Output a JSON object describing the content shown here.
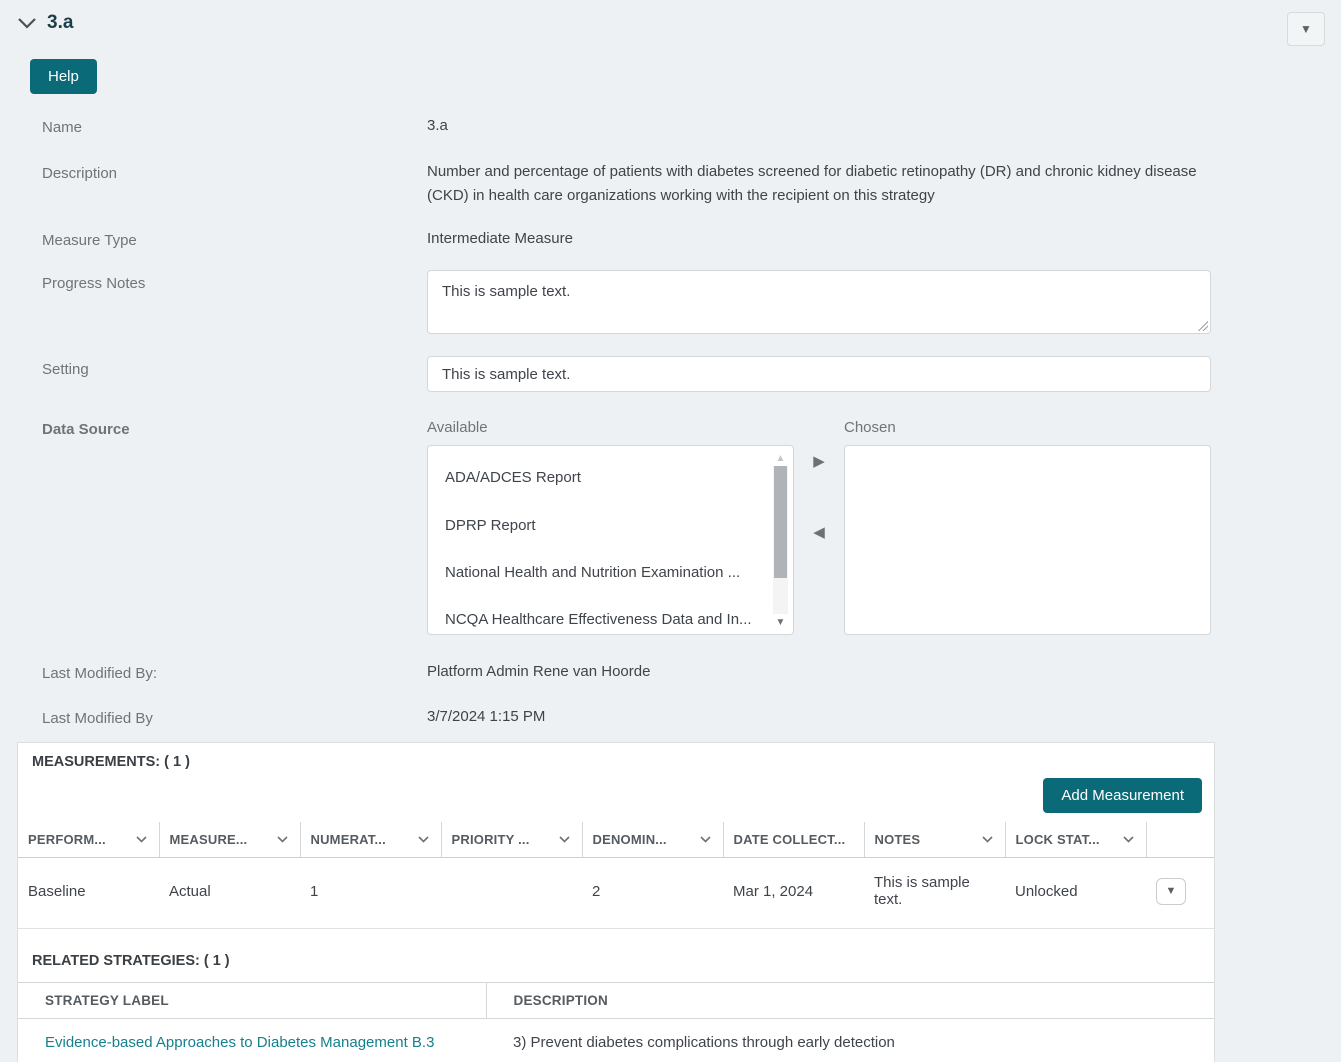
{
  "header": {
    "section_title": "3.a",
    "collapse_icon": "chevron-down",
    "menu_icon": "caret-down",
    "help_button_label": "Help"
  },
  "fields": {
    "name": {
      "label": "Name",
      "value": "3.a"
    },
    "description": {
      "label": "Description",
      "value": "Number and percentage of patients with diabetes screened for diabetic retinopathy (DR) and chronic kidney disease (CKD) in health care organizations working with the recipient on this strategy"
    },
    "measure_type": {
      "label": "Measure Type",
      "value": "Intermediate Measure"
    },
    "progress_notes": {
      "label": "Progress Notes",
      "value": "This is sample text."
    },
    "setting": {
      "label": "Setting",
      "value": "This is sample text."
    },
    "data_source": {
      "label": "Data Source",
      "available_label": "Available",
      "chosen_label": "Chosen",
      "available_options": [
        "ADA/ADCES Report",
        "DPRP Report",
        "National Health and Nutrition Examination ...",
        "NCQA Healthcare Effectiveness Data and In..."
      ],
      "chosen_options": []
    },
    "last_modified_by": {
      "label": "Last Modified By:",
      "value": "Platform Admin Rene van Hoorde"
    },
    "last_modified_date": {
      "label": "Last Modified By",
      "value": "3/7/2024 1:15 PM"
    }
  },
  "measurements": {
    "title": "MEASUREMENTS: ( 1 )",
    "add_button_label": "Add Measurement",
    "columns": [
      {
        "label": "PERFORM..."
      },
      {
        "label": "MEASURE..."
      },
      {
        "label": "NUMERAT..."
      },
      {
        "label": "PRIORITY ..."
      },
      {
        "label": "DENOMIN..."
      },
      {
        "label": "DATE COLLECT..."
      },
      {
        "label": "NOTES"
      },
      {
        "label": "LOCK STAT..."
      },
      {
        "label": ""
      }
    ],
    "rows": [
      {
        "performance": "Baseline",
        "measure": "Actual",
        "numerator": "1",
        "priority": "",
        "denominator": "2",
        "date_collected": "Mar 1, 2024",
        "notes": "This is sample text.",
        "lock_status": "Unlocked"
      }
    ]
  },
  "related_strategies": {
    "title": "RELATED STRATEGIES: ( 1 )",
    "columns": {
      "label": "STRATEGY LABEL",
      "description": "DESCRIPTION"
    },
    "rows": [
      {
        "label": "Evidence-based Approaches to Diabetes Management B.3",
        "description": "3) Prevent diabetes complications through early detection"
      }
    ]
  },
  "colors": {
    "accent_teal": "#0b6a77",
    "link_teal": "#16808e",
    "page_background": "#edf1f3",
    "heading_text": "#1c3e4a",
    "label_text": "#6e7479",
    "value_text": "#3f444a"
  }
}
